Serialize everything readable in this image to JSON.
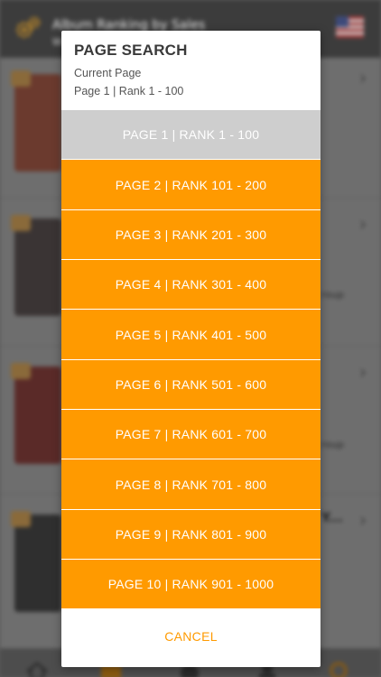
{
  "app": {
    "title": "Album Ranking by Sales",
    "subtitle": "W",
    "settings_icon": "gear-icon",
    "region_icon": "us-flag-icon"
  },
  "background_list": {
    "side_text_1": "roup",
    "side_text_2": "roup",
    "truncated_title": "Y..."
  },
  "tabbar": {
    "icons": [
      "home-icon",
      "calendar-icon",
      "chart-icon",
      "person-icon",
      "search-icon"
    ]
  },
  "dialog": {
    "title": "PAGE SEARCH",
    "current_label": "Current Page",
    "current_value": "Page 1 | Rank 1 - 100",
    "pages": [
      {
        "label": "PAGE 1 | RANK 1 - 100",
        "current": true
      },
      {
        "label": "PAGE 2 | RANK 101 - 200",
        "current": false
      },
      {
        "label": "PAGE 3 | RANK 201 - 300",
        "current": false
      },
      {
        "label": "PAGE 4 | RANK 301 - 400",
        "current": false
      },
      {
        "label": "PAGE 5 | RANK 401 - 500",
        "current": false
      },
      {
        "label": "PAGE 6 | RANK 501 - 600",
        "current": false
      },
      {
        "label": "PAGE 7 | RANK 601 - 700",
        "current": false
      },
      {
        "label": "PAGE 8 | RANK 701 - 800",
        "current": false
      },
      {
        "label": "PAGE 9 | RANK 801 - 900",
        "current": false
      },
      {
        "label": "PAGE 10 | RANK 901 - 1000",
        "current": false
      }
    ],
    "cancel_label": "CANCEL"
  },
  "colors": {
    "accent": "#ff9a00",
    "current_page_bg": "#cecece",
    "header_bg": "#3c3c3c"
  }
}
